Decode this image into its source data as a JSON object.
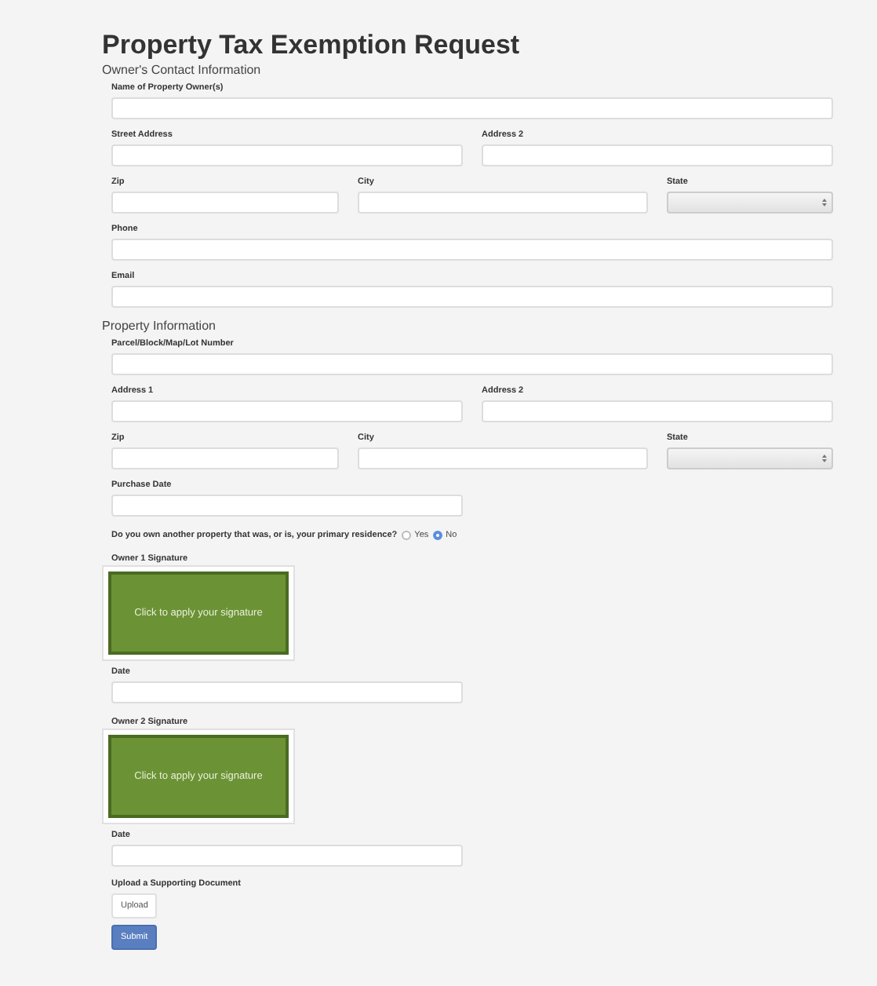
{
  "title": "Property Tax Exemption Request",
  "sections": [
    {
      "heading": "Owner's Contact Information",
      "items": [
        {
          "kind": "row",
          "fields": [
            {
              "label": "Name of Property Owner(s)",
              "kind": "text"
            }
          ]
        },
        {
          "kind": "row",
          "fields": [
            {
              "label": "Street Address",
              "kind": "text"
            },
            {
              "label": "Address 2",
              "kind": "text"
            }
          ]
        },
        {
          "kind": "row",
          "fields": [
            {
              "label": "Zip",
              "kind": "text"
            },
            {
              "label": "City",
              "kind": "text"
            },
            {
              "label": "State",
              "kind": "dropdown"
            }
          ]
        },
        {
          "kind": "row",
          "fields": [
            {
              "label": "Phone",
              "kind": "text"
            }
          ]
        },
        {
          "kind": "row",
          "fields": [
            {
              "label": "Email",
              "kind": "text"
            }
          ]
        }
      ]
    },
    {
      "heading": "Property Information",
      "items": [
        {
          "kind": "row",
          "fields": [
            {
              "label": "Parcel/Block/Map/Lot Number",
              "kind": "text"
            }
          ]
        },
        {
          "kind": "row",
          "fields": [
            {
              "label": "Address 1",
              "kind": "text"
            },
            {
              "label": "Address 2",
              "kind": "text"
            }
          ]
        },
        {
          "kind": "row",
          "fields": [
            {
              "label": "Zip",
              "kind": "text"
            },
            {
              "label": "City",
              "kind": "text"
            },
            {
              "label": "State",
              "kind": "dropdown"
            }
          ]
        },
        {
          "kind": "narrow",
          "fields": [
            {
              "label": "Purchase Date",
              "kind": "text"
            }
          ]
        },
        {
          "kind": "question",
          "text": "Do you own another property that was, or is, your primary residence?",
          "options": [
            {
              "label": "Yes",
              "selected": false
            },
            {
              "label": "No",
              "selected": true
            }
          ]
        },
        {
          "kind": "signature",
          "label": "Owner 1 Signature",
          "prompt": "Click to apply your signature"
        },
        {
          "kind": "narrow",
          "fields": [
            {
              "label": "Date",
              "kind": "text"
            }
          ]
        },
        {
          "kind": "signature",
          "label": "Owner 2 Signature",
          "prompt": "Click to apply your signature"
        },
        {
          "kind": "narrow",
          "fields": [
            {
              "label": "Date",
              "kind": "text"
            }
          ]
        },
        {
          "kind": "upload",
          "label": "Upload a Supporting Document",
          "button": "Upload"
        }
      ]
    }
  ],
  "submit_button": "Submit"
}
